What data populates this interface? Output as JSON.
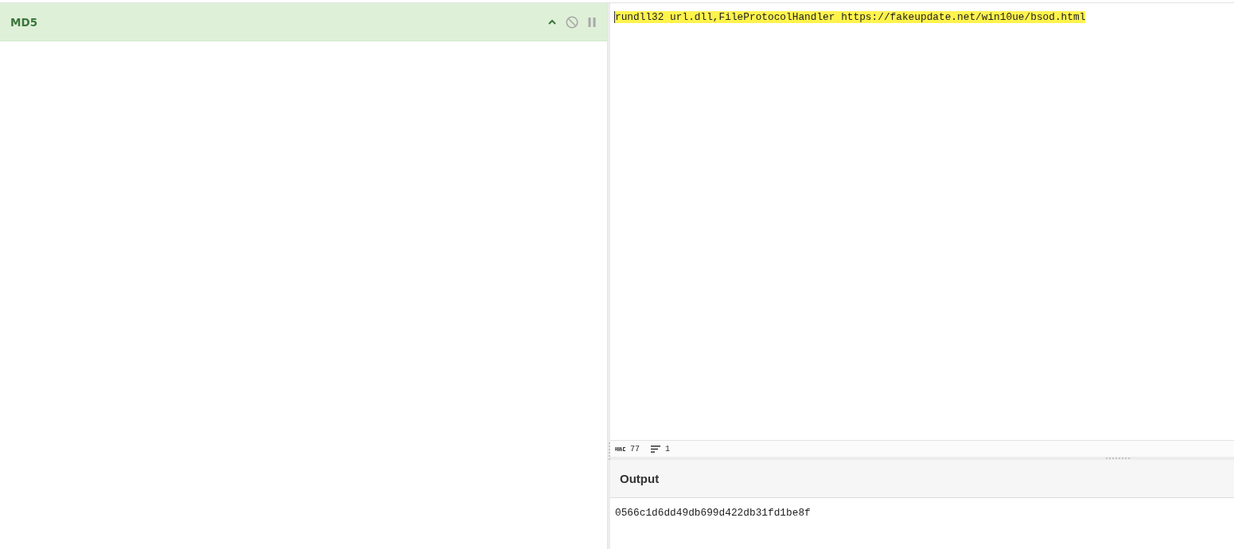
{
  "recipe": {
    "operations": [
      {
        "name": "MD5",
        "disabled": false,
        "breakpoint": false
      }
    ]
  },
  "input": {
    "text": "rundll32 url.dll,FileProtocolHandler https://fakeupdate.net/win10ue/bsod.html",
    "highlighted": true,
    "stats": [
      {
        "kind": "length",
        "value": "77"
      },
      {
        "kind": "lines",
        "value": "1"
      }
    ]
  },
  "output": {
    "title": "Output",
    "text": "0566c1d6dd49db699d422db31fd1be8f"
  }
}
